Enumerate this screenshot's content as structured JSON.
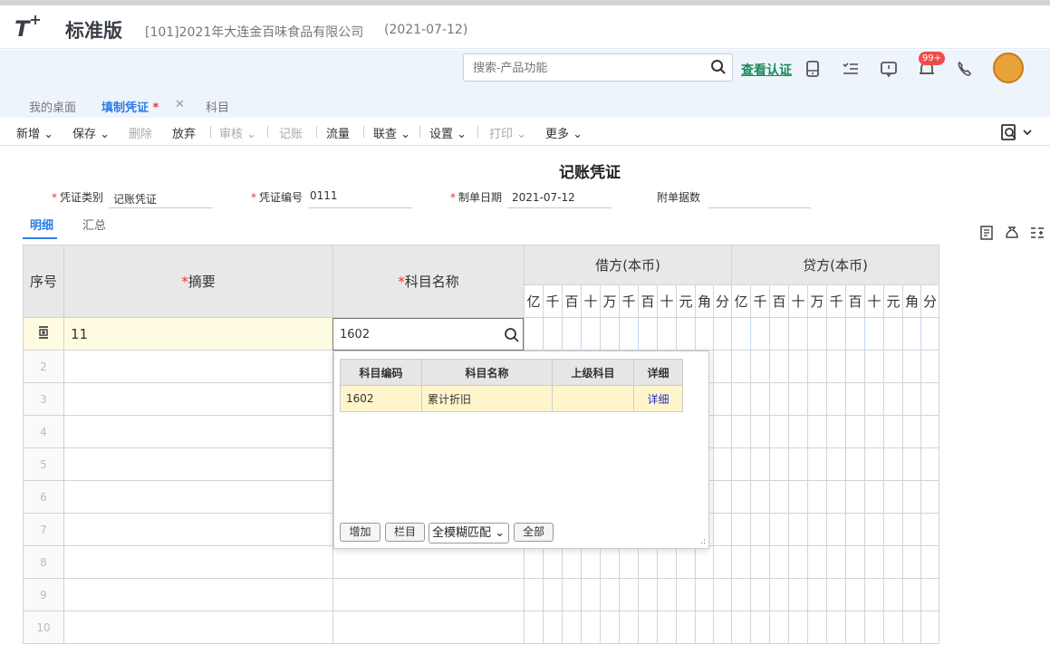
{
  "header": {
    "logo": "T+",
    "edition": "标准版",
    "company": "[101]2021年大连金百味食品有限公司",
    "date": "(2021-07-12)",
    "search_placeholder": "搜索-产品功能",
    "verify_link": "查看认证",
    "badge": "99+"
  },
  "tabs": [
    "我的桌面",
    "填制凭证",
    "科目"
  ],
  "active_tab_star": "*",
  "toolbar": {
    "new": "新增",
    "save": "保存",
    "delete": "删除",
    "discard": "放弃",
    "review": "审核",
    "post": "记账",
    "flow": "流量",
    "query": "联查",
    "settings": "设置",
    "print": "打印",
    "more": "更多"
  },
  "voucher": {
    "title": "记账凭证",
    "type_label": "凭证类别",
    "type_value": "记账凭证",
    "number_label": "凭证编号",
    "number_value": "0111",
    "date_label": "制单日期",
    "date_value": "2021-07-12",
    "attach_label": "附单据数",
    "attach_value": ""
  },
  "subtabs": [
    "明细",
    "汇总"
  ],
  "grid": {
    "col_seq": "序号",
    "col_summary": "摘要",
    "col_account": "科目名称",
    "col_debit": "借方(本币)",
    "col_credit": "贷方(本币)",
    "digits": [
      "亿",
      "千",
      "百",
      "十",
      "万",
      "千",
      "百",
      "十",
      "元",
      "角",
      "分"
    ],
    "row1_summary": "11",
    "row1_account": "1602",
    "row_numbers": [
      "2",
      "3",
      "4",
      "5",
      "6",
      "7",
      "8",
      "9",
      "10"
    ]
  },
  "popup": {
    "headers": [
      "科目编码",
      "科目名称",
      "上级科目",
      "详细"
    ],
    "row": {
      "code": "1602",
      "name": "累计折旧",
      "parent": "",
      "detail": "详细"
    },
    "btn_add": "增加",
    "btn_columns": "栏目",
    "select_value": "全模糊匹配",
    "btn_all": "全部"
  },
  "colors": {
    "accent": "#2b7de9",
    "highlight": "#fffbe0"
  }
}
